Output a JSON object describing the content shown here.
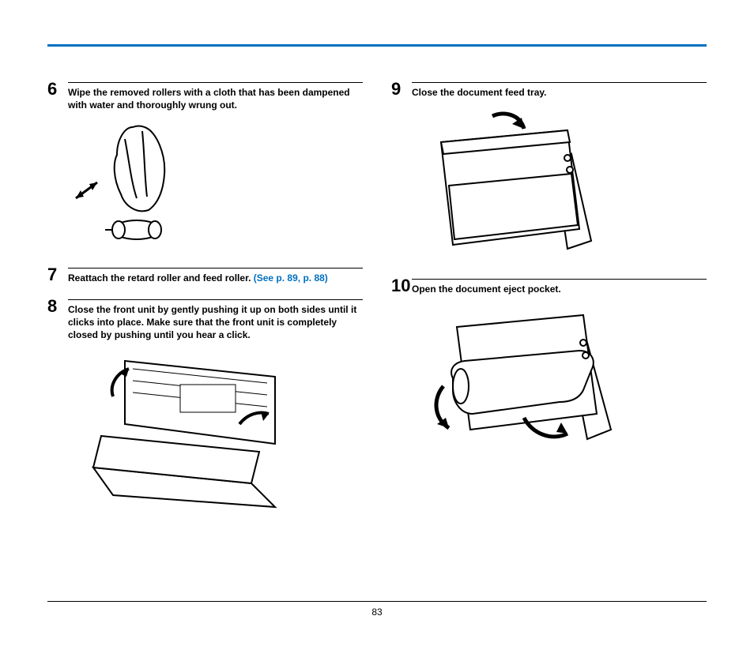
{
  "page_number": "83",
  "left": {
    "steps": [
      {
        "num": "6",
        "text": "Wipe the removed rollers with a cloth that has been dampened with water and thoroughly wrung out."
      },
      {
        "num": "7",
        "text": "Reattach the retard roller and feed roller. ",
        "xref": "(See p. 89, p. 88)"
      },
      {
        "num": "8",
        "text": "Close the front unit by gently pushing it up on both sides until it clicks into place. Make sure that the front unit is completely closed by pushing until you hear a click."
      }
    ]
  },
  "right": {
    "steps": [
      {
        "num": "9",
        "text": "Close the document feed tray."
      },
      {
        "num": "10",
        "text": "Open the document eject pocket."
      }
    ]
  }
}
